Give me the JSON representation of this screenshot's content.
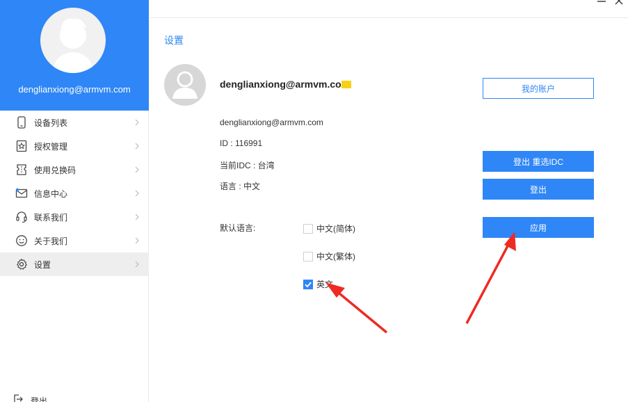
{
  "sidebar": {
    "email": "denglianxiong@armvm.com",
    "items": [
      {
        "label": "设备列表",
        "icon": "phone-icon"
      },
      {
        "label": "授权管理",
        "icon": "star-badge-icon"
      },
      {
        "label": "使用兑换码",
        "icon": "ticket-icon"
      },
      {
        "label": "信息中心",
        "icon": "mail-icon"
      },
      {
        "label": "联系我们",
        "icon": "headset-icon"
      },
      {
        "label": "关于我们",
        "icon": "smile-icon"
      },
      {
        "label": "设置",
        "icon": "gear-icon"
      }
    ],
    "logout_label": "登出"
  },
  "settings": {
    "title": "设置",
    "user_name": "denglianxiong@armvm.co",
    "email": "denglianxiong@armvm.com",
    "id_text": "ID : 116991",
    "idc_text": "当前IDC : 台湾",
    "language_text": "语言 : 中文",
    "default_language_label": "默认语言:",
    "options": [
      {
        "label": "中文(简体)",
        "checked": false
      },
      {
        "label": "中文(繁体)",
        "checked": false
      },
      {
        "label": "英文",
        "checked": true
      }
    ],
    "buttons": {
      "my_account": "我的账户",
      "logout_reselect": "登出 重选IDC",
      "logout": "登出",
      "apply": "应用"
    }
  },
  "colors": {
    "accent": "#2f86f6",
    "annotation_arrow": "#ee2a24"
  }
}
